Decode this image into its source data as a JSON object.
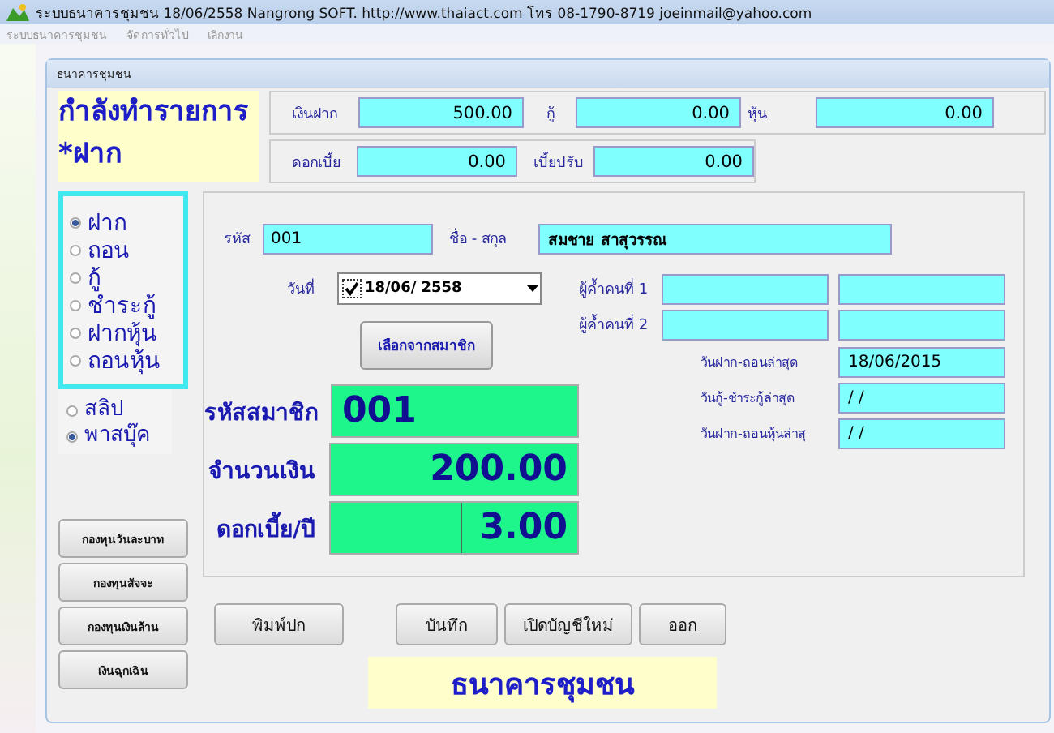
{
  "window": {
    "title": "ระบบธนาคารชุมชน 18/06/2558  Nangrong SOFT. http://www.thaiact.com  โทร 08-1790-8719 joeinmail@yahoo.com"
  },
  "menu": [
    "ระบบธนาคารชุมชน",
    "จัดการทั่วไป",
    "เลิกงาน"
  ],
  "form": {
    "title": "ธนาคารชุมชน",
    "status_lines": [
      "กำลังทำรายการ",
      "*ฝาก"
    ],
    "summary_rows": [
      [
        {
          "label": "เงินฝาก",
          "value": "500.00"
        },
        {
          "label": "กู้",
          "value": "0.00"
        },
        {
          "label": "หุ้น",
          "value": "0.00"
        }
      ],
      [
        {
          "label": "ดอกเบี้ย",
          "value": "0.00"
        },
        {
          "label": "เบี้ยปรับ",
          "value": "0.00"
        }
      ]
    ],
    "transaction_types": [
      {
        "label": "ฝาก",
        "selected": true
      },
      {
        "label": "ถอน",
        "selected": false
      },
      {
        "label": "กู้",
        "selected": false
      },
      {
        "label": "ชำระกู้",
        "selected": false
      },
      {
        "label": "ฝากหุ้น",
        "selected": false
      },
      {
        "label": "ถอนหุ้น",
        "selected": false
      }
    ],
    "print_modes": [
      {
        "label": "สลิป",
        "selected": false
      },
      {
        "label": "พาสบุ๊ค",
        "selected": true
      }
    ],
    "fund_buttons": [
      "กองทุนวันละบาท",
      "กองทุนสัจจะ",
      "กองทุนเงินล้าน",
      "เงินฉุกเฉิน"
    ],
    "member": {
      "id_label": "รหัส",
      "id": "001",
      "name_label": "ชื่อ - สกุล",
      "name": "สมชาย สาสุวรรณ"
    },
    "date": {
      "label": "วันที่",
      "checked": true,
      "value": "18/06/ 2558"
    },
    "guarantors": [
      {
        "label": "ผู้ค้ำคนที่ 1"
      },
      {
        "label": "ผู้ค้ำคนที่ 2"
      }
    ],
    "pick_button": "เลือกจากสมาชิก",
    "last_dates": [
      {
        "label": "วันฝาก-ถอนล่าสุด",
        "value": "18/06/2015"
      },
      {
        "label": "วันกู้-ชำระกู้ล่าสุด",
        "value": "/ /"
      },
      {
        "label": "วันฝาก-ถอนหุ้นล่าสุ",
        "value": "/ /"
      }
    ],
    "big_fields": [
      {
        "label": "รหัสสมาชิก",
        "value": "001",
        "kind": "code"
      },
      {
        "label": "จำนวนเงิน",
        "value": "200.00",
        "kind": "amount"
      },
      {
        "label": "ดอกเบี้ย/ปี",
        "value": "3.00",
        "kind": "split"
      }
    ],
    "actions": [
      "พิมพ์ปก",
      "บันทึก",
      "เปิดบัญชีใหม่",
      "ออก"
    ],
    "footer": "ธนาคารชุมชน"
  }
}
